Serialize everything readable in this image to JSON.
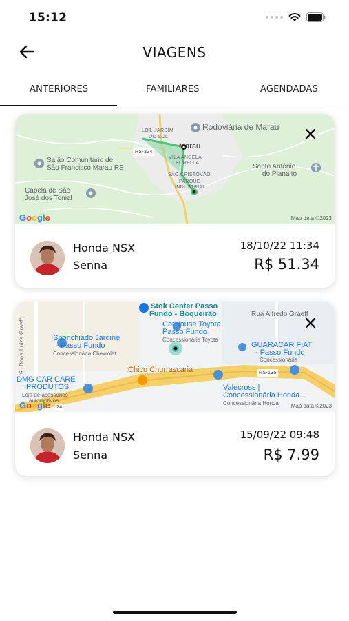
{
  "status_bar": {
    "time": "15:12"
  },
  "header": {
    "title": "VIAGENS",
    "back_icon": "arrow-left-icon"
  },
  "tabs": [
    {
      "label": "ANTERIORES",
      "active": true
    },
    {
      "label": "FAMILIARES",
      "active": false
    },
    {
      "label": "AGENDADAS",
      "active": false
    }
  ],
  "trips": [
    {
      "vehicle": "Honda NSX",
      "driver": "Senna",
      "date": "18/10/22 11:34",
      "price": "R$ 51.34",
      "map": {
        "labels": {
          "lot_jardim": "LOT. JARDIM",
          "do_sol": "DO SOL",
          "rodoviaria": "Rodoviária de Marau",
          "rs324": "RS-324",
          "marau": "Marau",
          "vila_angela": "VILA ANGELA",
          "borella": "BORELLA",
          "salao1": "Salão Comunitário de",
          "salao2": "São Francisco,Marau RS",
          "sao_cristovao": "SÃO CRISTÓVÃO",
          "parque": "PARQUE",
          "industrial": "INDUSTRIAL",
          "santo_antonio1": "Santo Antônio",
          "santo_antonio2": "do Planalto",
          "capela1": "Capela de São",
          "capela2": "José dos Tonial"
        },
        "google": "Google",
        "map_data": "Map data ©2023"
      }
    },
    {
      "vehicle": "Honda NSX",
      "driver": "Senna",
      "date": "15/09/22 09:48",
      "price": "R$ 7.99",
      "map": {
        "labels": {
          "stok1": "Stok Center Passo",
          "stok2": "Fundo - Boqueirão",
          "rua_dona": "R. Dona Luiza Graeff",
          "rua_alfredo": "Rua Alfredo Graeff",
          "carhouse1": "CarHouse Toyota",
          "carhouse2": "Passo Fundo",
          "carhouse3": "Concessionária Toyota",
          "sponchiado1": "Sponchiado Jardine",
          "sponchiado2": "- Passo Fundo",
          "sponchiado3": "Concessionária Chevrolet",
          "guaracar1": "GUARACAR FIAT",
          "guaracar2": "- Passo Fundo",
          "guaracar3": "Concessionária",
          "chico": "Chico Churrascaria",
          "rs135": "RS-135",
          "dmg1": "DMG CAR CARE",
          "dmg2": "PRODUTOS",
          "dmg3": "Loja de acessórios",
          "dmg4": "automotivos",
          "valecross1": "Valecross |",
          "valecross2": "Concessionária Honda...",
          "valecross3": "Concessionária Honda",
          "road24": "24"
        },
        "google": "Google",
        "map_data": "Map data ©2023"
      }
    }
  ]
}
